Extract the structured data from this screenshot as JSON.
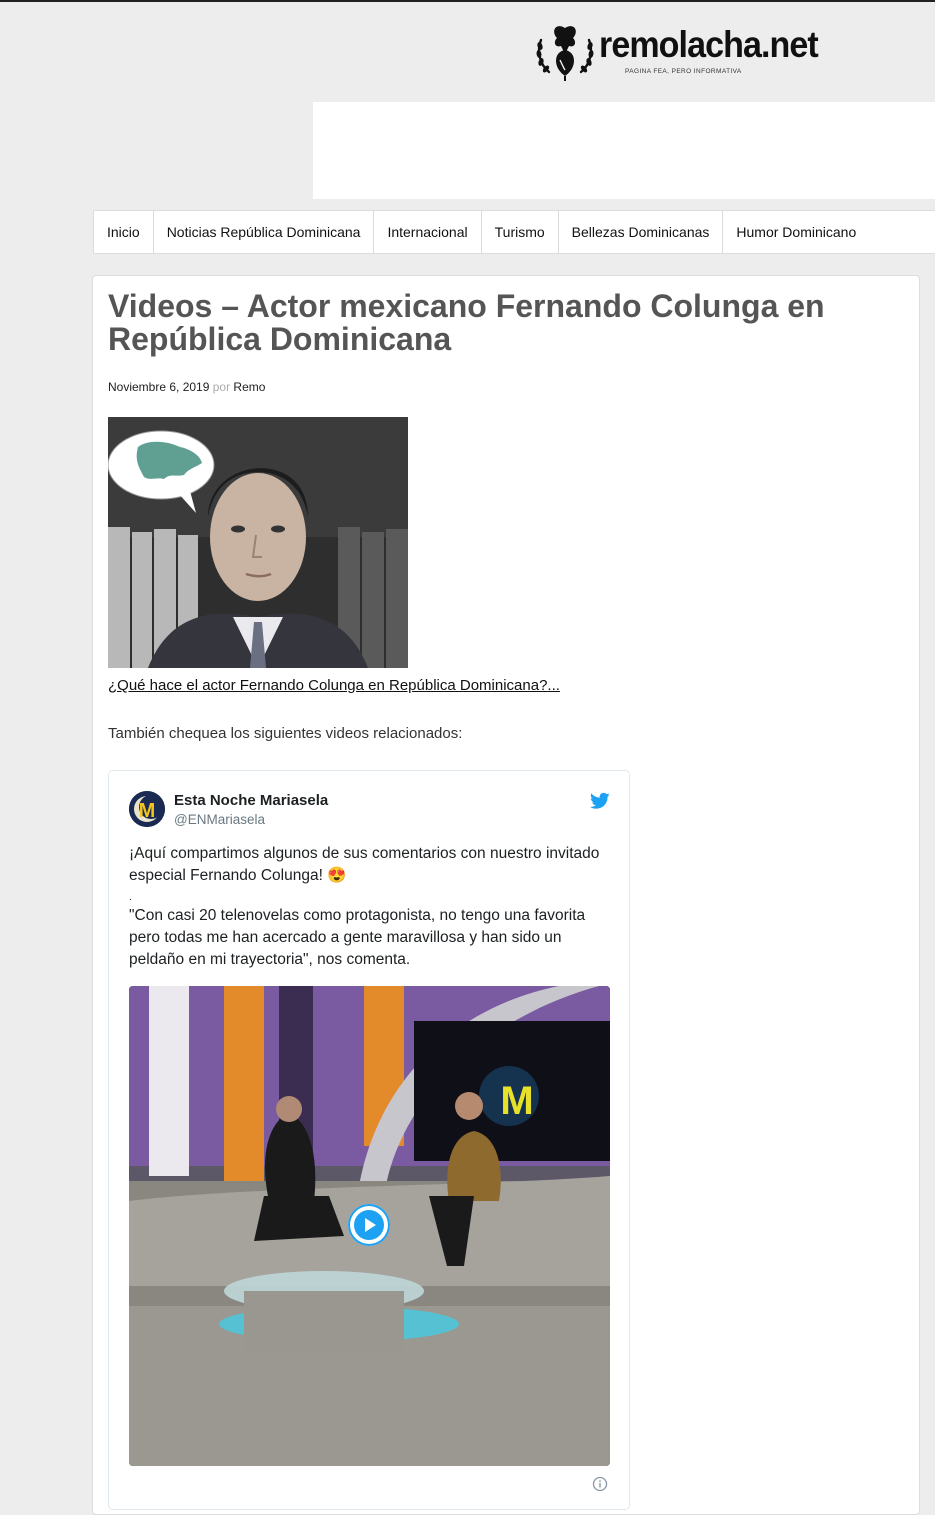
{
  "site": {
    "logo_text": "remolacha.net",
    "tagline": "PAGINA FEA, PERO INFORMATIVA"
  },
  "nav": {
    "items": [
      "Inicio",
      "Noticias República Dominicana",
      "Internacional",
      "Turismo",
      "Bellezas Dominicanas",
      "Humor Dominicano"
    ]
  },
  "article": {
    "title": "Videos – Actor mexicano Fernando Colunga en República Dominicana",
    "date": "Noviembre 6, 2019",
    "by_label": "por",
    "author": "Remo",
    "image_link": "¿Qué hace el actor Fernando Colunga en República Dominicana?...",
    "related_intro": "También chequea los siguientes videos relacionados:"
  },
  "tweet": {
    "name": "Esta Noche Mariasela",
    "handle": "@ENMariasela",
    "line1": "¡Aquí compartimos algunos de sus comentarios con nuestro invitado especial Fernando Colunga! 😍",
    "dot": ".",
    "line2": "\"Con casi 20 telenovelas como protagonista, no tengo una favorita pero todas me han acercado a gente maravillosa y han sido un peldaño en mi trayectoria\", nos comenta.",
    "avatar_letter": "M",
    "brand_color": "#1da1f2"
  }
}
